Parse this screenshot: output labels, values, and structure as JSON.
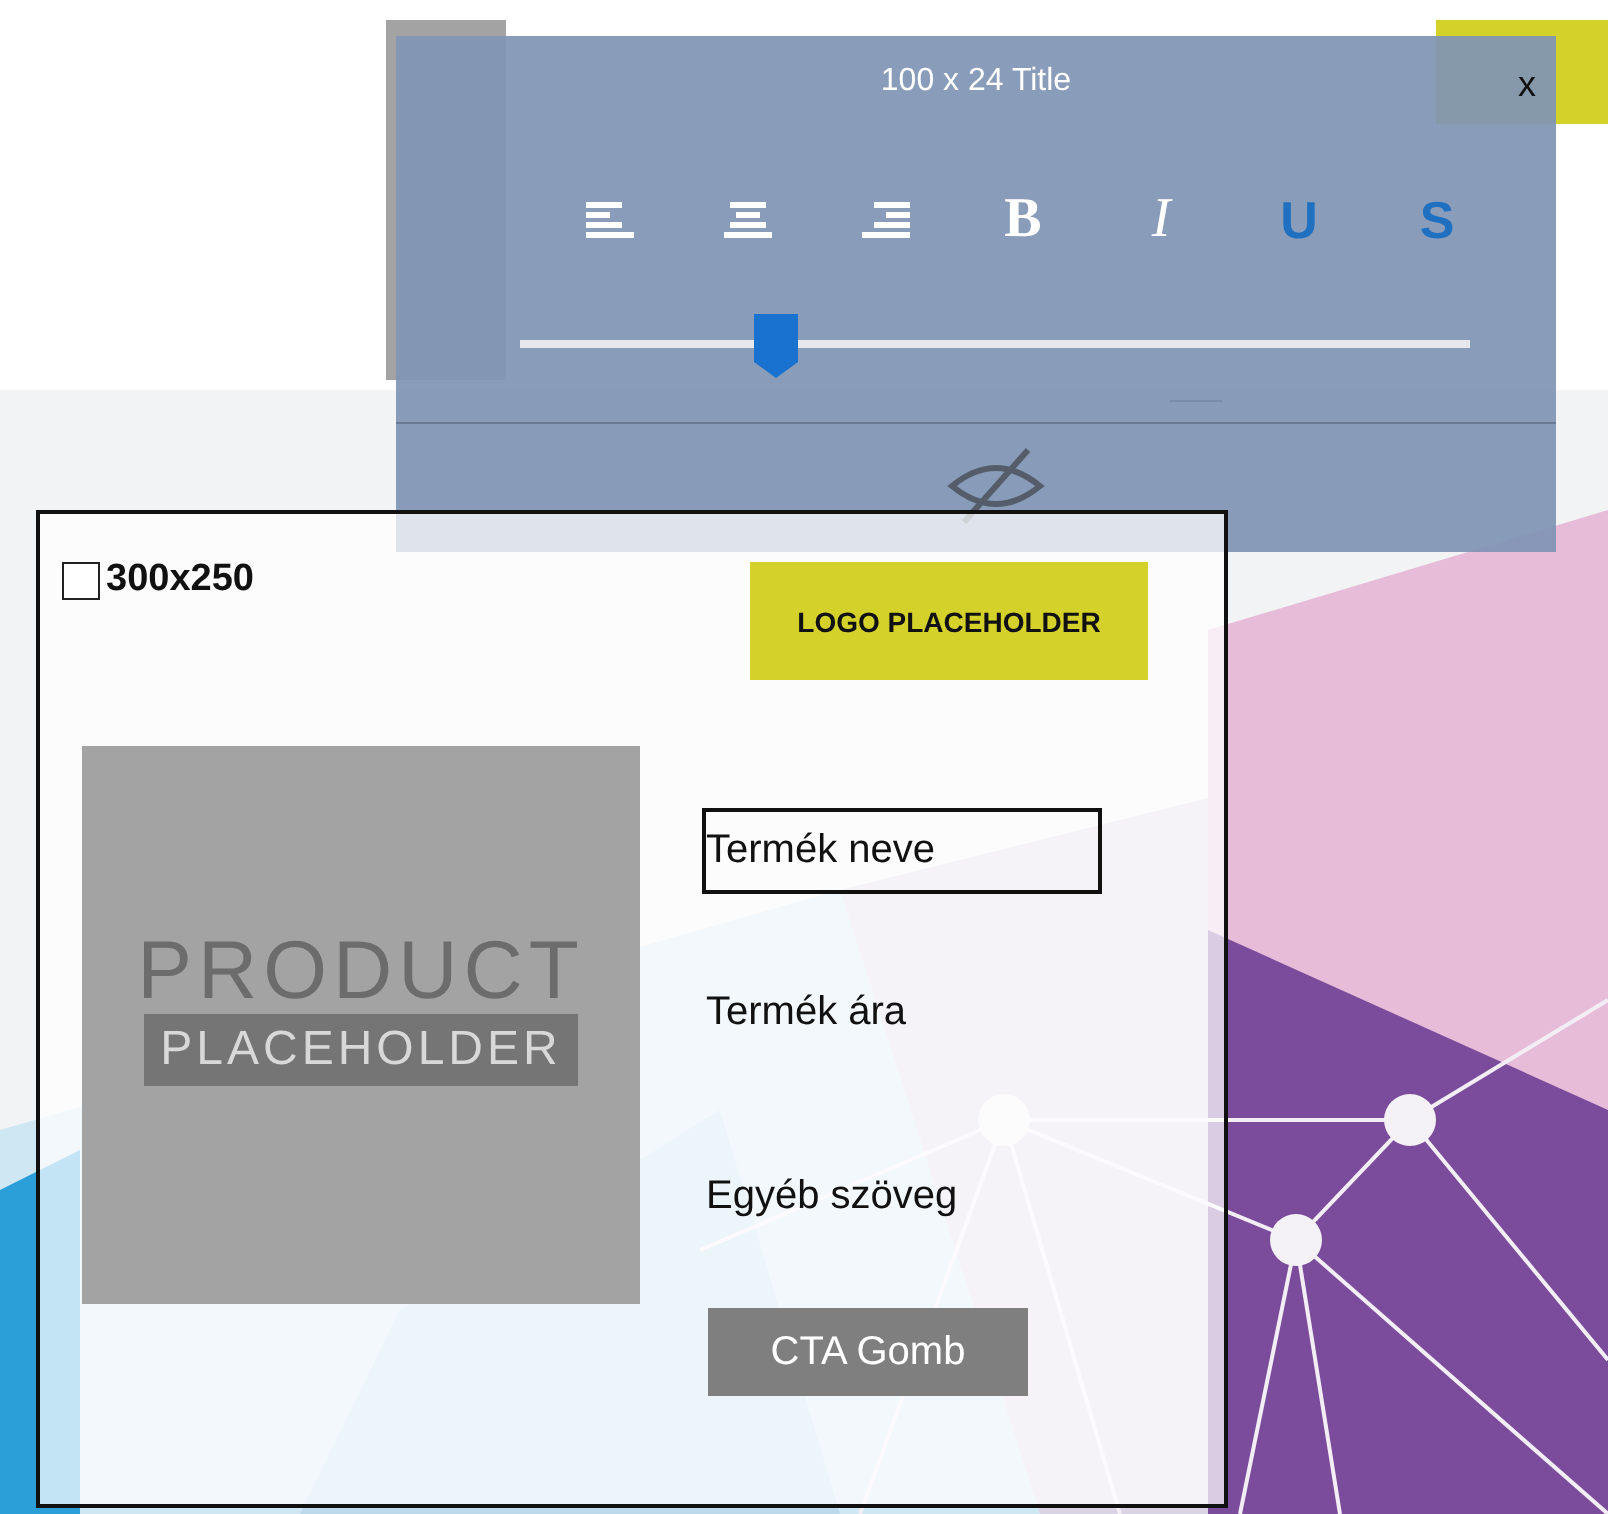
{
  "toolbar": {
    "title": "100 x 24 Title",
    "close": "x",
    "buttons": [
      {
        "kind": "align-left"
      },
      {
        "kind": "align-center"
      },
      {
        "kind": "align-right"
      },
      {
        "kind": "bold",
        "label": "B"
      },
      {
        "kind": "italic",
        "label": "I"
      },
      {
        "kind": "underline",
        "label": "U"
      },
      {
        "kind": "strike",
        "label": "S"
      }
    ],
    "slider": {
      "level": 0.27
    }
  },
  "banner": {
    "size": "300x250",
    "checked": false,
    "logo": "LOGO PLACEHOLDER",
    "product": {
      "line1": "PRODUCT",
      "line2": "PLACEHOLDER"
    },
    "items": [
      {
        "kind": "name",
        "text": "Termék neve"
      },
      {
        "kind": "price",
        "text": "Termék ára"
      },
      {
        "kind": "other",
        "text": "Egyéb szöveg"
      },
      {
        "kind": "cta",
        "text": "CTA Gomb"
      }
    ]
  }
}
